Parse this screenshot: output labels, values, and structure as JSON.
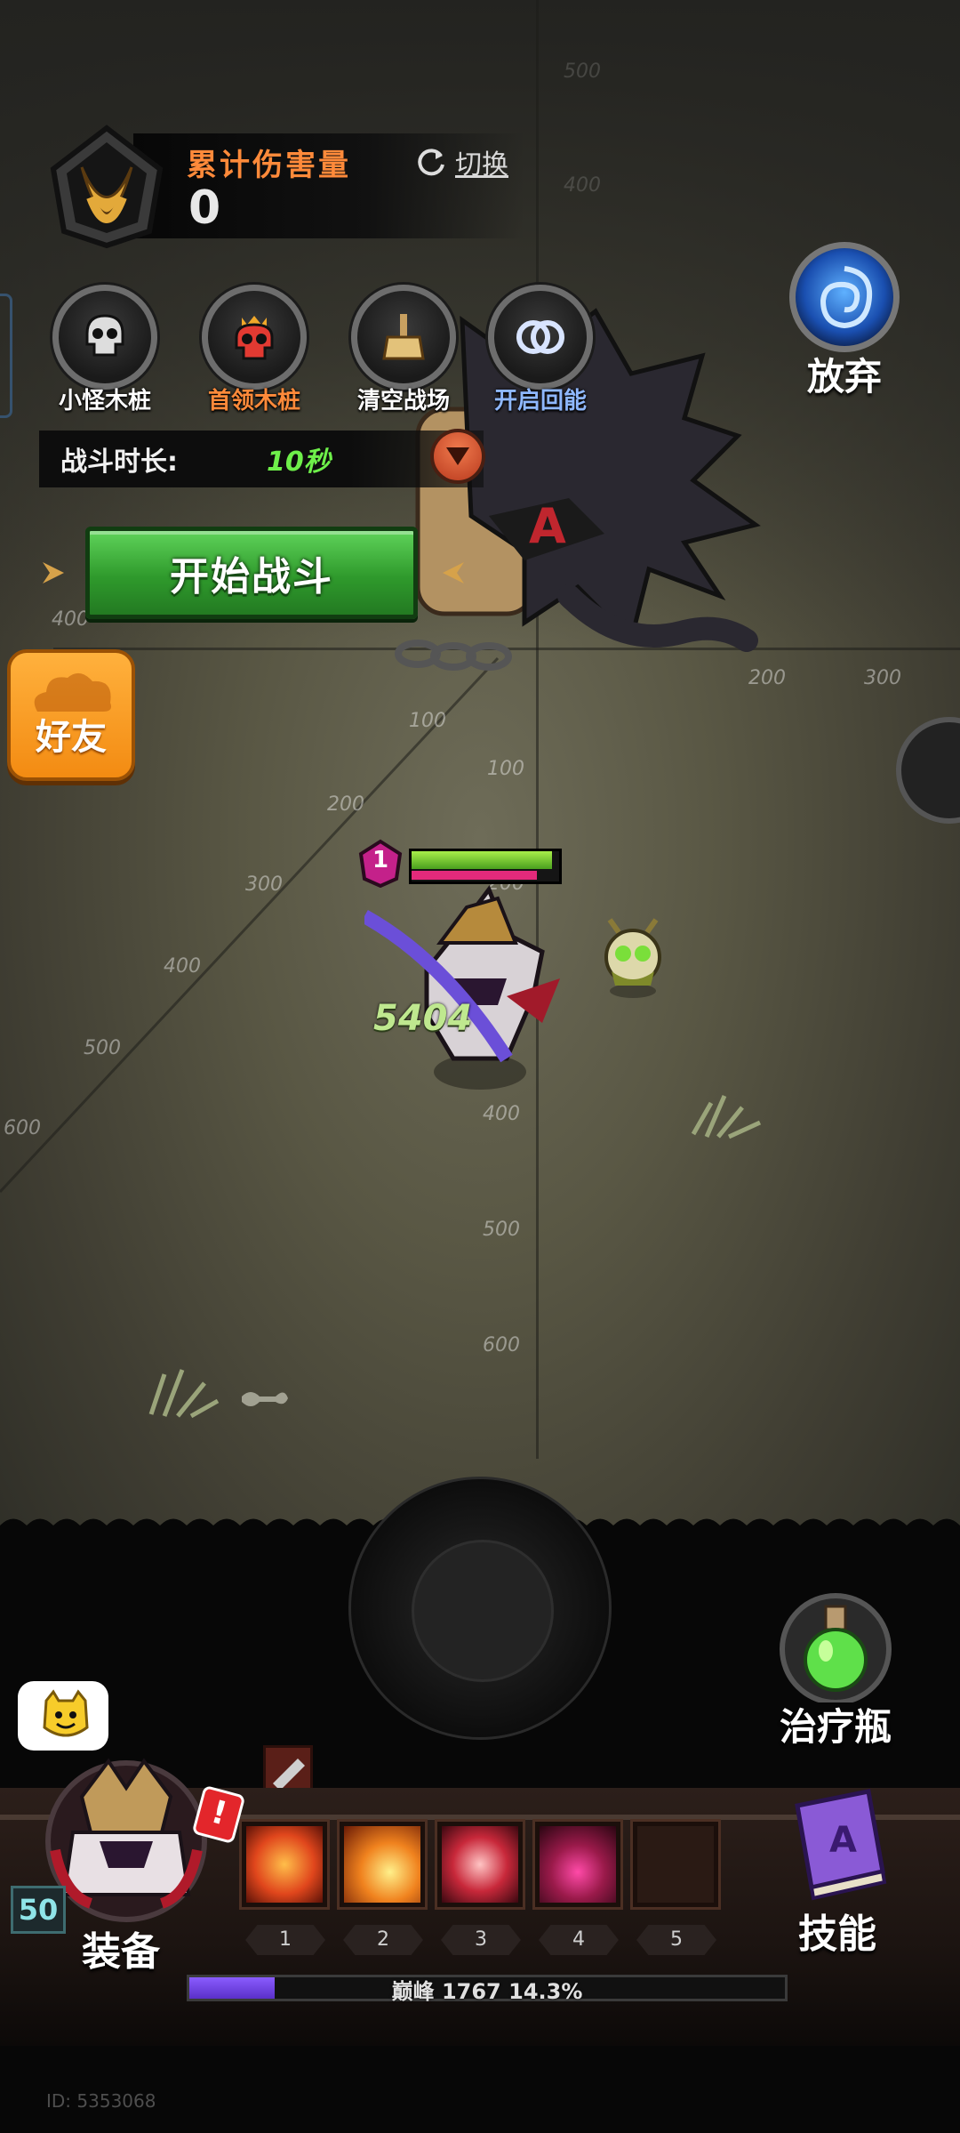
{
  "damage_panel": {
    "title": "累计伤害量",
    "value": "0",
    "switch_label": "切换"
  },
  "controls": [
    {
      "label": "小怪木桩",
      "color": "#ffffff",
      "icon": "skull-icon"
    },
    {
      "label": "首领木桩",
      "color": "#ff8a3a",
      "icon": "red-skull-crown-icon"
    },
    {
      "label": "清空战场",
      "color": "#ffffff",
      "icon": "broom-icon"
    },
    {
      "label": "开启回能",
      "color": "#8fb8ff",
      "icon": "rings-icon"
    }
  ],
  "give_up": {
    "label": "放弃"
  },
  "battle_duration": {
    "label": "战斗时长:",
    "value": "10秒"
  },
  "start_battle": {
    "label": "开始战斗"
  },
  "friends": {
    "label": "好友"
  },
  "arena_ticks": {
    "vertical": [
      "100",
      "200",
      "300",
      "400",
      "500",
      "600"
    ],
    "diagonal": [
      "100",
      "200",
      "300",
      "400",
      "500",
      "600"
    ],
    "horizontal": [
      "400",
      "200",
      "300"
    ],
    "upper_faded": [
      "500",
      "400"
    ]
  },
  "player": {
    "level": "1",
    "hp_fraction": 0.95,
    "mana_fraction": 0.85
  },
  "floating_damage": "5404",
  "potion": {
    "label": "治疗瓶"
  },
  "equipment": {
    "label": "装备",
    "level": "50",
    "alert": "!"
  },
  "skills_button": {
    "label": "技能"
  },
  "skill_slots": [
    {
      "number": "1",
      "color": "#e0461c",
      "icon": "fire-orb-icon"
    },
    {
      "number": "2",
      "color": "#f0821e",
      "icon": "fireball-icon"
    },
    {
      "number": "3",
      "color": "#c8283a",
      "icon": "slash-icon"
    },
    {
      "number": "4",
      "color": "#9a1a4a",
      "icon": "demon-icon"
    },
    {
      "number": "5",
      "color": "#2a1a14",
      "icon": "empty-slot"
    }
  ],
  "xp": {
    "text": "巅峰 1767  14.3%",
    "fraction": 0.143
  },
  "user_id": "ID: 5353068",
  "colors": {
    "accent_green": "#3db83a",
    "accent_orange": "#f39a1c",
    "damage_title": "#ff8a3a"
  }
}
